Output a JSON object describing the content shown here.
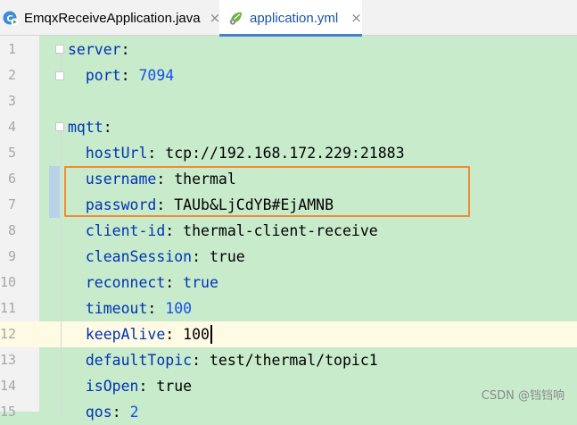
{
  "tabs": [
    {
      "label": "EmqxReceiveApplication.java",
      "close": "×",
      "icon": "java-class-run-icon",
      "active": false
    },
    {
      "label": "application.yml",
      "close": "×",
      "icon": "spring-yaml-icon",
      "active": true
    }
  ],
  "colors": {
    "code_bg": "#c8ebcc",
    "key": "#0033b3",
    "number": "#1750eb",
    "highlight_box": "#f08c33",
    "current_line": "#fffae3",
    "active_tab_underline": "#4083c9"
  },
  "editor": {
    "current_line": 12,
    "highlighted_lines": [
      6,
      7
    ],
    "lines": [
      {
        "num": "1",
        "indent": "",
        "key": "server",
        "sep": ":",
        "value": "",
        "vtype": "plain"
      },
      {
        "num": "2",
        "indent": "  ",
        "key": "port",
        "sep": ": ",
        "value": "7094",
        "vtype": "number"
      },
      {
        "num": "3",
        "indent": "",
        "key": "",
        "sep": "",
        "value": "",
        "vtype": "plain"
      },
      {
        "num": "4",
        "indent": "",
        "key": "mqtt",
        "sep": ":",
        "value": "",
        "vtype": "plain"
      },
      {
        "num": "5",
        "indent": "  ",
        "key": "hostUrl",
        "sep": ": ",
        "value": "tcp://192.168.172.229:21883",
        "vtype": "plain"
      },
      {
        "num": "6",
        "indent": "  ",
        "key": "username",
        "sep": ": ",
        "value": "thermal",
        "vtype": "plain"
      },
      {
        "num": "7",
        "indent": "  ",
        "key": "password",
        "sep": ": ",
        "value": "TAUb&LjCdYB#EjAMNB",
        "vtype": "plain"
      },
      {
        "num": "8",
        "indent": "  ",
        "key": "client-id",
        "sep": ": ",
        "value": "thermal-client-receive",
        "vtype": "plain"
      },
      {
        "num": "9",
        "indent": "  ",
        "key": "cleanSession",
        "sep": ": ",
        "value": "true",
        "vtype": "plain"
      },
      {
        "num": "10",
        "indent": "  ",
        "key": "reconnect",
        "sep": ": ",
        "value": "true",
        "vtype": "keyword"
      },
      {
        "num": "11",
        "indent": "  ",
        "key": "timeout",
        "sep": ": ",
        "value": "100",
        "vtype": "number"
      },
      {
        "num": "12",
        "indent": "  ",
        "key": "keepAlive",
        "sep": ": ",
        "value": "100",
        "vtype": "plain"
      },
      {
        "num": "13",
        "indent": "  ",
        "key": "defaultTopic",
        "sep": ": ",
        "value": "test/thermal/topic1",
        "vtype": "plain"
      },
      {
        "num": "14",
        "indent": "  ",
        "key": "isOpen",
        "sep": ": ",
        "value": "true",
        "vtype": "plain"
      },
      {
        "num": "15",
        "indent": "  ",
        "key": "qos",
        "sep": ": ",
        "value": "2",
        "vtype": "number"
      }
    ]
  },
  "watermark": "CSDN @铛铛响"
}
